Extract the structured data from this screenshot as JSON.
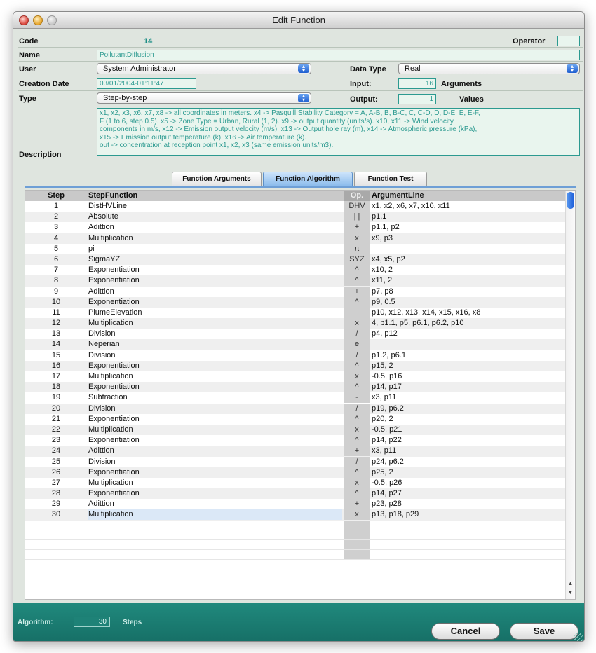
{
  "window": {
    "title": "Edit Function"
  },
  "form": {
    "code_label": "Code",
    "code_value": "14",
    "operator_label": "Operator",
    "operator_value": "",
    "name_label": "Name",
    "name_value": "PollutantDiffusion",
    "user_label": "User",
    "user_value": "System Administrator",
    "data_type_label": "Data Type",
    "data_type_value": "Real",
    "creation_date_label": "Creation Date",
    "creation_date_value": "03/01/2004-01:11:47",
    "input_label": "Input:",
    "input_value": "16",
    "arguments_label": "Arguments",
    "type_label": "Type",
    "type_value": "Step-by-step",
    "output_label": "Output:",
    "output_value": "1",
    "values_label": "Values",
    "description_label": "Description",
    "description_lines": [
      "x1, x2, x3, x6, x7, x8 -> all coordinates in meters. x4 -> Pasquill Stability Category = A, A-B, B, B-C, C, C-D, D, D-E, E, E-F,",
      "F (1 to 6, step 0.5). x5 -> Zone Type = Urban, Rural (1, 2). x9 -> output quantity (units/s). x10, x11 -> Wind velocity",
      "components in m/s, x12 -> Emission output velocity (m/s), x13 -> Output hole ray (m), x14 -> Atmospheric pressure (kPa),",
      "x15 -> Emission output temperature (k), x16 -> Air temperature (k).",
      "out -> concentration at reception point x1, x2, x3 (same emission units/m3)."
    ]
  },
  "tabs": [
    "Function Arguments",
    "Function Algorithm",
    "Function Test"
  ],
  "table": {
    "headers": {
      "step": "Step",
      "function": "StepFunction",
      "op": "Op.",
      "args": "ArgumentLine"
    },
    "rows": [
      {
        "step": "1",
        "fn": "DistHVLine",
        "op": "DHV",
        "args": "x1, x2, x6, x7, x10, x11"
      },
      {
        "step": "2",
        "fn": "Absolute",
        "op": "| |",
        "args": "p1.1"
      },
      {
        "step": "3",
        "fn": "Adittion",
        "op": "+",
        "args": "p1.1, p2"
      },
      {
        "step": "4",
        "fn": "Multiplication",
        "op": "x",
        "args": "x9, p3"
      },
      {
        "step": "5",
        "fn": "pi",
        "op": "π",
        "args": ""
      },
      {
        "step": "6",
        "fn": "SigmaYZ",
        "op": "SYZ",
        "args": "x4, x5, p2"
      },
      {
        "step": "7",
        "fn": "Exponentiation",
        "op": "^",
        "args": "x10, 2"
      },
      {
        "step": "8",
        "fn": "Exponentiation",
        "op": "^",
        "args": "x11, 2"
      },
      {
        "step": "9",
        "fn": "Adittion",
        "op": "+",
        "args": "p7, p8"
      },
      {
        "step": "10",
        "fn": "Exponentiation",
        "op": "^",
        "args": "p9, 0.5"
      },
      {
        "step": "11",
        "fn": "PlumeElevation",
        "op": "",
        "args": "p10, x12, x13, x14, x15, x16, x8"
      },
      {
        "step": "12",
        "fn": "Multiplication",
        "op": "x",
        "args": "4, p1.1, p5, p6.1, p6.2, p10"
      },
      {
        "step": "13",
        "fn": "Division",
        "op": "/",
        "args": "p4, p12"
      },
      {
        "step": "14",
        "fn": "Neperian",
        "op": "e",
        "args": ""
      },
      {
        "step": "15",
        "fn": "Division",
        "op": "/",
        "args": "p1.2, p6.1"
      },
      {
        "step": "16",
        "fn": "Exponentiation",
        "op": "^",
        "args": "p15, 2"
      },
      {
        "step": "17",
        "fn": "Multiplication",
        "op": "x",
        "args": "-0.5, p16"
      },
      {
        "step": "18",
        "fn": "Exponentiation",
        "op": "^",
        "args": "p14, p17"
      },
      {
        "step": "19",
        "fn": "Subtraction",
        "op": "-",
        "args": "x3, p11"
      },
      {
        "step": "20",
        "fn": "Division",
        "op": "/",
        "args": "p19, p6.2"
      },
      {
        "step": "21",
        "fn": "Exponentiation",
        "op": "^",
        "args": "p20, 2"
      },
      {
        "step": "22",
        "fn": "Multiplication",
        "op": "x",
        "args": "-0.5, p21"
      },
      {
        "step": "23",
        "fn": "Exponentiation",
        "op": "^",
        "args": "p14, p22"
      },
      {
        "step": "24",
        "fn": "Adittion",
        "op": "+",
        "args": "x3, p11"
      },
      {
        "step": "25",
        "fn": "Division",
        "op": "/",
        "args": "p24, p6.2"
      },
      {
        "step": "26",
        "fn": "Exponentiation",
        "op": "^",
        "args": "p25, 2"
      },
      {
        "step": "27",
        "fn": "Multiplication",
        "op": "x",
        "args": "-0.5, p26"
      },
      {
        "step": "28",
        "fn": "Exponentiation",
        "op": "^",
        "args": "p14, p27"
      },
      {
        "step": "29",
        "fn": "Adittion",
        "op": "+",
        "args": "p23, p28"
      },
      {
        "step": "30",
        "fn": "Multiplication",
        "op": "x",
        "args": "p13, p18, p29"
      }
    ],
    "selected_step": "30"
  },
  "footer": {
    "algorithm_label": "Algorithm:",
    "algorithm_value": "30",
    "steps_label": "Steps",
    "cancel_label": "Cancel",
    "save_label": "Save"
  },
  "colors": {
    "accent_teal": "#1d8e86",
    "tab_active": "#8cbcec",
    "footer": "#1a7a70"
  }
}
